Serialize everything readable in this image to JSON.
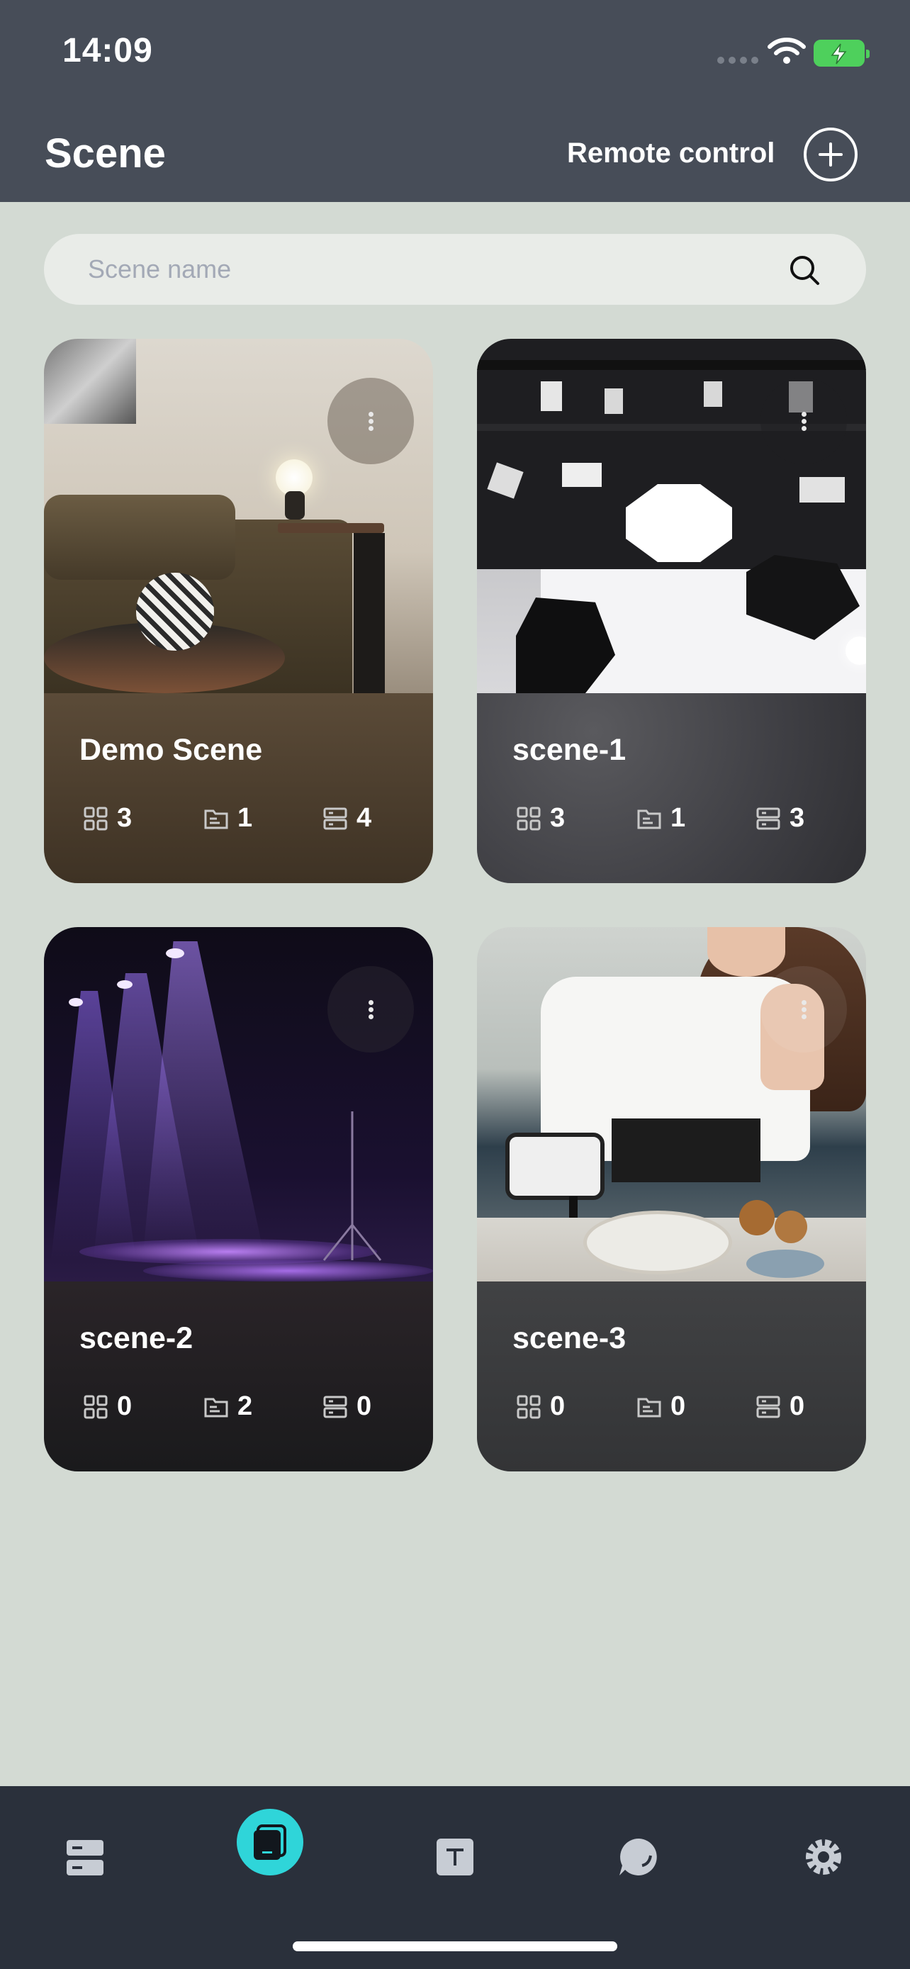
{
  "status_bar": {
    "time": "14:09"
  },
  "header": {
    "title": "Scene",
    "remote_label": "Remote control"
  },
  "search": {
    "placeholder": "Scene name",
    "value": ""
  },
  "scenes": [
    {
      "name": "Demo Scene",
      "stats": [
        "3",
        "1",
        "4"
      ],
      "info_color": "#4a3b2c",
      "photo": "living room with sofa and lamp"
    },
    {
      "name": "scene-1",
      "stats": [
        "3",
        "1",
        "3"
      ],
      "info_color": "#3f3f44",
      "photo": "photo studio with softboxes"
    },
    {
      "name": "scene-2",
      "stats": [
        "0",
        "2",
        "0"
      ],
      "info_color": "#1c1c1f",
      "photo": "stage with purple spotlights"
    },
    {
      "name": "scene-3",
      "stats": [
        "0",
        "0",
        "0"
      ],
      "info_color": "#38393a",
      "photo": "woman filming with phone in kitchen"
    }
  ],
  "nav": [
    "devices-icon",
    "scene-icon",
    "text-icon",
    "chat-icon",
    "settings-icon"
  ],
  "colors": {
    "accent": "#2fd5d9",
    "header_bg": "#474d58",
    "page_bg": "#d3dad3",
    "nav_bg": "#2a303b"
  }
}
